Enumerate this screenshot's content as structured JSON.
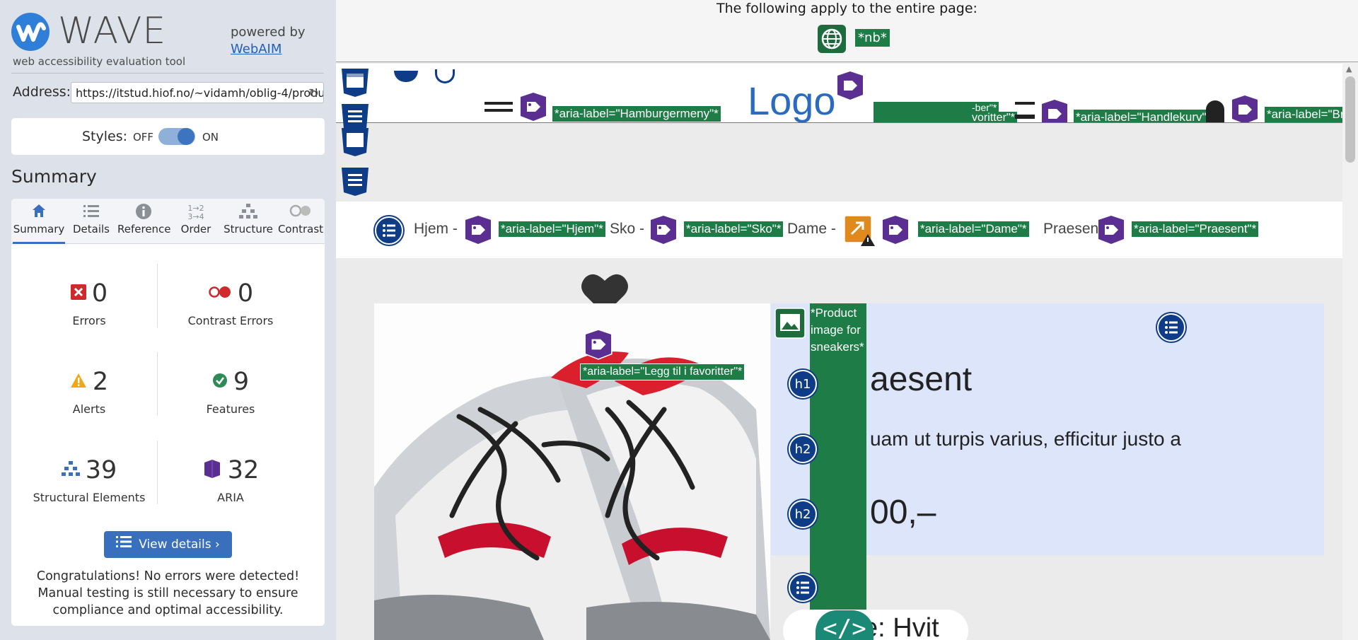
{
  "sidebar": {
    "logo_title": "WAVE",
    "logo_subtitle": "web accessibility evaluation tool",
    "powered_by": "powered by",
    "webaim_link": "WebAIM",
    "address_label": "Address:",
    "address_value": "https://itstud.hiof.no/~vidamh/oblig-4/produ",
    "styles_label": "Styles:",
    "styles_off": "OFF",
    "styles_on": "ON",
    "summary_heading": "Summary",
    "tabs": [
      {
        "label": "Summary",
        "icon": "home-icon"
      },
      {
        "label": "Details",
        "icon": "list-icon"
      },
      {
        "label": "Reference",
        "icon": "info-icon"
      },
      {
        "label": "Order",
        "icon": "order-icon"
      },
      {
        "label": "Structure",
        "icon": "structure-icon"
      },
      {
        "label": "Contrast",
        "icon": "contrast-icon"
      }
    ],
    "stats": {
      "errors": {
        "value": "0",
        "label": "Errors"
      },
      "contrast_errors": {
        "value": "0",
        "label": "Contrast Errors"
      },
      "alerts": {
        "value": "2",
        "label": "Alerts"
      },
      "features": {
        "value": "9",
        "label": "Features"
      },
      "structural": {
        "value": "39",
        "label": "Structural Elements"
      },
      "aria": {
        "value": "32",
        "label": "ARIA"
      }
    },
    "view_details": "View details ›",
    "congrats": "Congratulations! No errors were detected! Manual testing is still necessary to ensure compliance and optimal accessibility."
  },
  "page": {
    "top_text": "The following apply to the entire page:",
    "lang_tag": "*nb*",
    "header_tags": {
      "hamburger": "*aria-label=\"Hamburgermeny\"*",
      "favoritter": "voritter\"*",
      "favoritter_top": "-ber\"*",
      "handlekurv": "*aria-label=\"Handlekurv\"*",
      "bruker": "*aria-label=\"Br"
    },
    "logo_text": "Logo",
    "breadcrumbs": [
      {
        "text": "Hjem -",
        "tag": "*aria-label=\"Hjem\"*"
      },
      {
        "text": "Sko -",
        "tag": "*aria-label=\"Sko\"*"
      },
      {
        "text": "Dame -",
        "tag": "*aria-label=\"Dame\"*"
      },
      {
        "text": "Praesent",
        "tag": "*aria-label=\"Praesent\"*"
      }
    ],
    "favorite_tag": "*aria-label=\"Legg til i favoritter\"*",
    "alt_text": "*Product image for sneakers*",
    "product_title": "aesent",
    "product_desc": "uam ut turpis varius, efficitur justo a",
    "product_price": "00,–",
    "color_text": "e: Hvit",
    "code_badge": "</>",
    "heading_badges": [
      "h1",
      "h2",
      "h2"
    ]
  },
  "colors": {
    "wave_green": "#1e7c46",
    "wave_purple": "#5b2e91",
    "wave_blue": "#0f3c86",
    "accent": "#3a6fbe"
  }
}
